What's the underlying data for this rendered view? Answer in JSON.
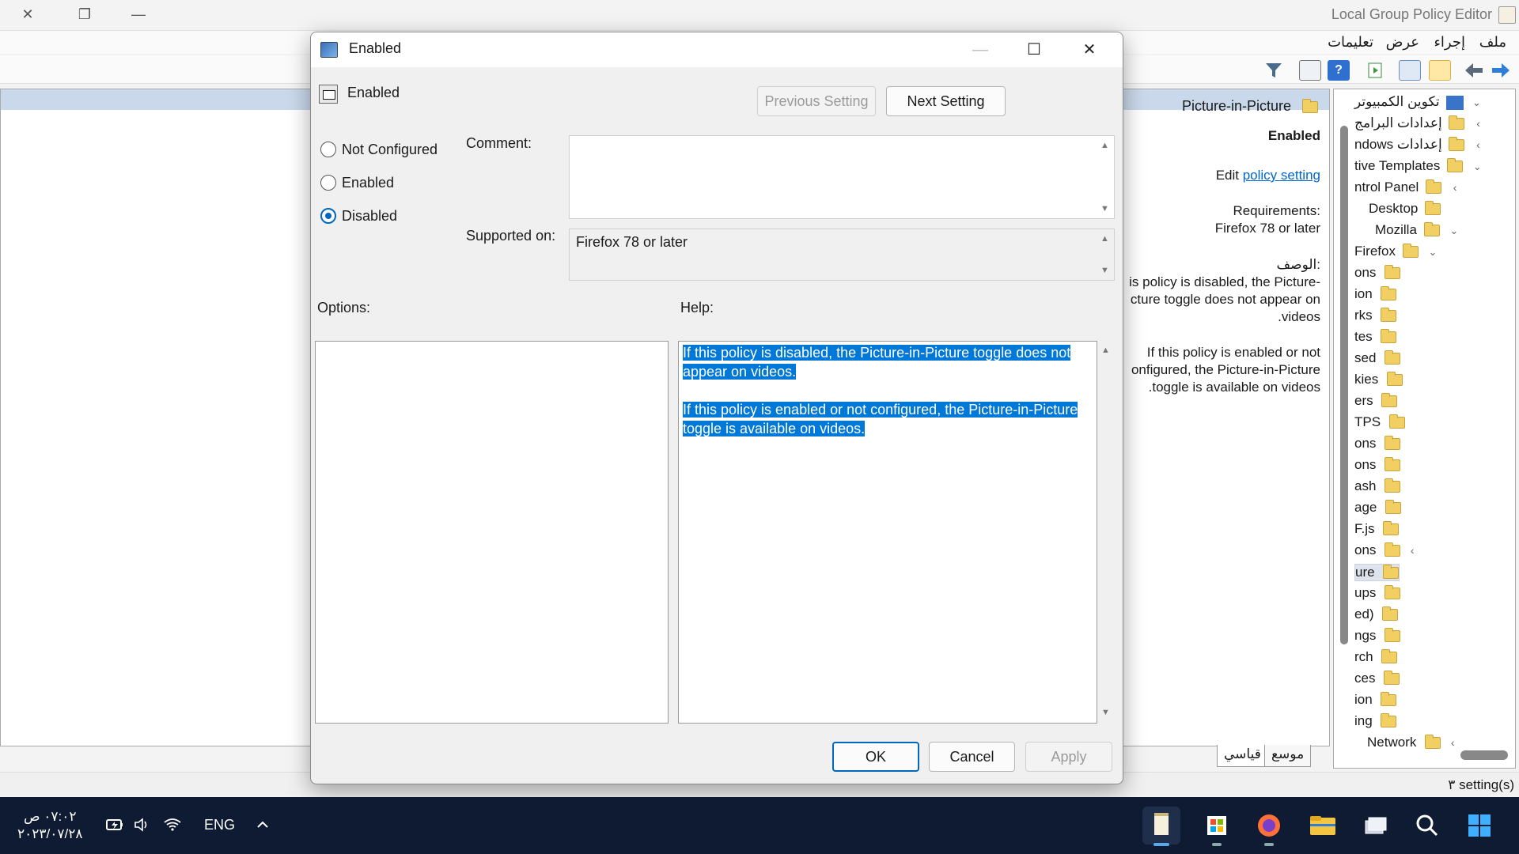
{
  "main_window": {
    "title": "Local Group Policy Editor",
    "menu": [
      "ملف",
      "إجراء",
      "عرض",
      "تعليمات"
    ],
    "extended_view": {
      "folder_title": "Picture-in-Picture",
      "setting_state": "Enabled",
      "edit_prefix": "Edit",
      "edit_link": "policy setting",
      "requirements_label": "Requirements:",
      "requirements_value": "Firefox 78 or later",
      "description_label": "الوصف:",
      "description_lines": [
        "is policy is disabled, the Picture-",
        "cture toggle does not appear on",
        "videos."
      ],
      "description_lines_2": [
        "If this policy is enabled or not",
        "onfigured, the Picture-in-Picture",
        "toggle is available on videos."
      ]
    },
    "tree": [
      {
        "label": "تكوين الكمبيوتر"
      },
      {
        "label": "إعدادات البرامج"
      },
      {
        "label": "ndows إعدادات"
      },
      {
        "label": "tive Templates"
      },
      {
        "label": "ntrol Panel"
      },
      {
        "label": "Desktop"
      },
      {
        "label": "Mozilla"
      },
      {
        "label": "Firefox"
      },
      {
        "label": "ons"
      },
      {
        "label": "ion"
      },
      {
        "label": "rks"
      },
      {
        "label": "tes"
      },
      {
        "label": "sed"
      },
      {
        "label": "kies"
      },
      {
        "label": "ers"
      },
      {
        "label": "TPS"
      },
      {
        "label": "ons"
      },
      {
        "label": "ons"
      },
      {
        "label": "ash"
      },
      {
        "label": "age"
      },
      {
        "label": "F.js"
      },
      {
        "label": "ons"
      },
      {
        "label": "ure"
      },
      {
        "label": "ups"
      },
      {
        "label": "ed)"
      },
      {
        "label": "ngs"
      },
      {
        "label": "rch"
      },
      {
        "label": "ces"
      },
      {
        "label": "ion"
      },
      {
        "label": "ing"
      },
      {
        "label": "Network"
      }
    ],
    "tabs": [
      "موسع",
      "قياسي"
    ],
    "status": "٣ setting(s)"
  },
  "dialog": {
    "title": "Enabled",
    "policy_name": "Enabled",
    "previous_label": "Previous Setting",
    "next_label": "Next Setting",
    "radios": [
      "Not Configured",
      "Enabled",
      "Disabled"
    ],
    "selected_radio": "Disabled",
    "comment_label": "Comment:",
    "comment_value": "",
    "supported_label": "Supported on:",
    "supported_value": "Firefox 78 or later",
    "options_label": "Options:",
    "help_label": "Help:",
    "help_p1_l1": "If this policy is disabled, the Picture-in-Picture toggle does not",
    "help_p1_l2": "appear on videos.",
    "help_p2_l1": "If this policy is enabled or not configured, the Picture-in-Picture",
    "help_p2_l2": "toggle is available on videos.",
    "ok_label": "OK",
    "cancel_label": "Cancel",
    "apply_label": "Apply"
  },
  "taskbar": {
    "time": "٠٧:٠٢ ص",
    "date": "٢٠٢٣/٠٧/٢٨",
    "language": "ENG"
  }
}
